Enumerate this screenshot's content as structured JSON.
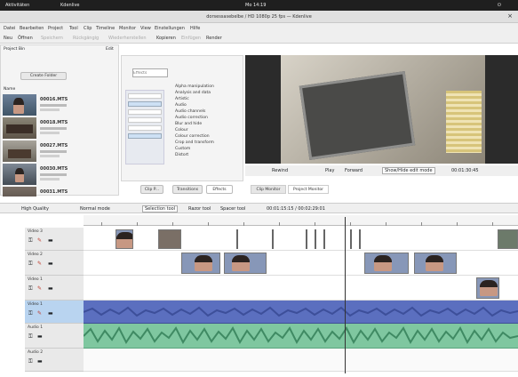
{
  "system_bar": {
    "activities": "Aktivitäten",
    "app_menu": "Kdenlive",
    "clock": "Mo 14:19"
  },
  "window": {
    "title": "dorsessasebelbe / HD 1080p 25 fps — Kdenlive"
  },
  "menu": [
    "Datei",
    "Bearbeiten",
    "Project",
    "Tool",
    "Clip",
    "Timeline",
    "Monitor",
    "View",
    "Einstellungen",
    "Hilfe"
  ],
  "toolbar": [
    "Neu",
    "Öffnen",
    "Speichern",
    "Rückgängig",
    "Wiederherstellen",
    "Kopieren",
    "Einfügen",
    "Render"
  ],
  "bin": {
    "title": "Project Bin",
    "edit": "Edit",
    "create_folder": "Create Folder",
    "name_header": "Name",
    "clips": [
      {
        "name": "00016.MTS"
      },
      {
        "name": "00018.MTS"
      },
      {
        "name": "00027.MTS"
      },
      {
        "name": "00030.MTS"
      },
      {
        "name": "00031.MTS"
      }
    ]
  },
  "effects": {
    "search_placeholder": "Effects",
    "categories": [
      "Alpha manipulation",
      "Analysis and data",
      "Artistic",
      "Audio",
      "Audio channels",
      "Audio correction",
      "Blur and hide",
      "Colour",
      "Colour correction",
      "Crop and transform",
      "Custom",
      "Distort"
    ],
    "buttons": [
      "Clip P...",
      "Transitions",
      "Effects"
    ]
  },
  "monitor": {
    "controls": {
      "rewind": "Rewind",
      "play": "Play",
      "forward": "Forward",
      "zone": "Show/Hide edit mode",
      "timecode": "00:01:30:45"
    },
    "tabs": [
      "Clip Monitor",
      "Project Monitor"
    ]
  },
  "timeline_toolbar": {
    "quality": "High Quality",
    "mode": "Normal mode",
    "tools": [
      "Selection tool",
      "Razor tool",
      "Spacer tool"
    ],
    "timecode": "00:01:15:15 / 00:02:29:01"
  },
  "tracks": [
    {
      "name": "Video 3",
      "kind": "video"
    },
    {
      "name": "Video 2",
      "kind": "video"
    },
    {
      "name": "Video 1",
      "kind": "video"
    },
    {
      "name": "Video 1",
      "kind": "audio"
    },
    {
      "name": "Audio 1",
      "kind": "audio"
    },
    {
      "name": "Audio 2",
      "kind": "audio"
    }
  ],
  "colors": {
    "audio_blue": "#5b6fbf",
    "audio_green": "#7fc7a0",
    "clip_blue": "#8797b8",
    "titlebar": "#e0e0e0"
  }
}
